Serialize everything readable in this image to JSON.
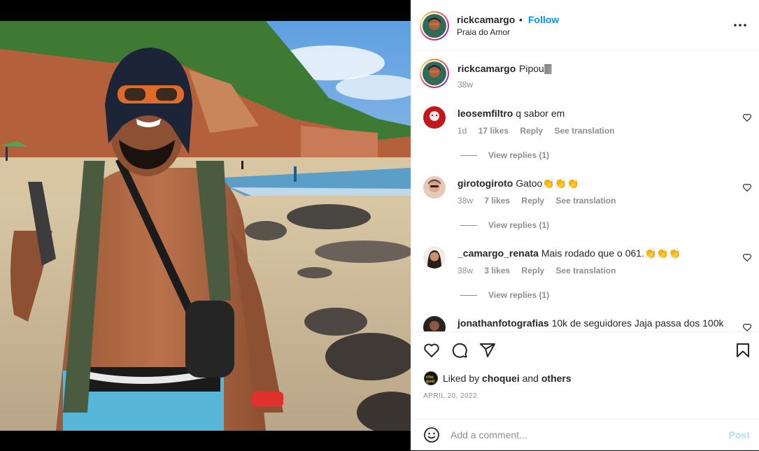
{
  "post": {
    "username": "rickcamargo",
    "follow_label": "Follow",
    "separator": "•",
    "location": "Praia do Amor"
  },
  "caption": {
    "username": "rickcamargo",
    "text": "Pipou🀫",
    "time": "38w"
  },
  "comments": [
    {
      "username": "leosemfiltro",
      "text": "q sabor em",
      "time": "1d",
      "likes": "17 likes",
      "reply": "Reply",
      "translate": "See translation",
      "view_replies": "View replies (1)"
    },
    {
      "username": "girotogiroto",
      "text": "Gatoo👏👏👏",
      "time": "38w",
      "likes": "7 likes",
      "reply": "Reply",
      "translate": "See translation",
      "view_replies": "View replies (1)"
    },
    {
      "username": "_camargo_renata",
      "text": "Mais rodado que o 061.👏👏👏",
      "time": "38w",
      "likes": "3 likes",
      "reply": "Reply",
      "translate": "See translation",
      "view_replies": "View replies (1)"
    },
    {
      "username": "jonathanfotografias",
      "text": "10k de seguidores Jaja passa dos 100k"
    }
  ],
  "likes": {
    "prefix": "Liked by",
    "user": "choquei",
    "connector": "and",
    "others": "others",
    "mini_avatar_text": "cho quei"
  },
  "date": "APRIL 20, 2022",
  "add_comment": {
    "placeholder": "Add a comment...",
    "post_label": "Post"
  },
  "colors": {
    "accent": "#0095f6",
    "post_disabled": "#b2dffc",
    "muted": "#8e8e8e"
  },
  "icons": [
    "more-options-icon",
    "heart-icon",
    "comment-icon",
    "share-icon",
    "bookmark-icon",
    "emoji-icon"
  ]
}
